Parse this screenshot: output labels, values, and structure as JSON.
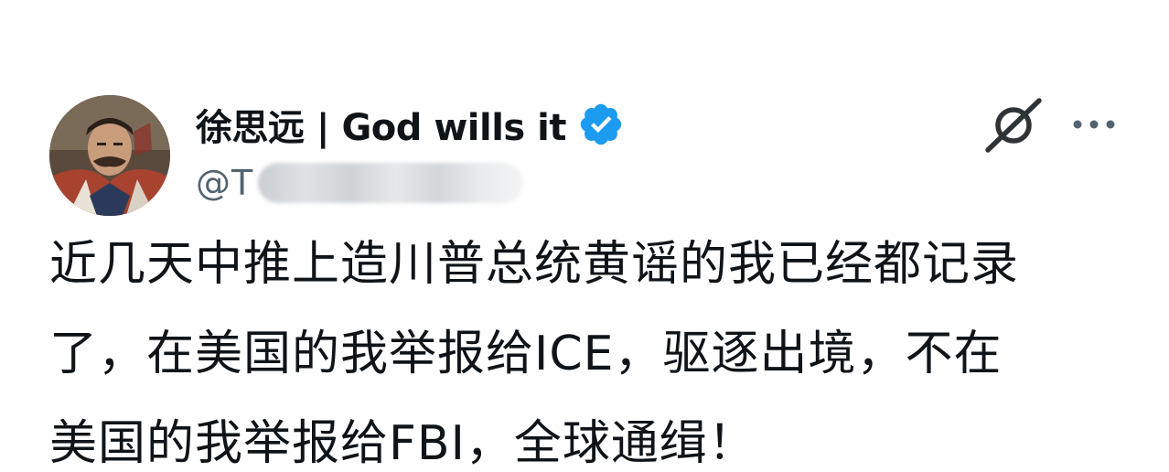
{
  "author": {
    "display_name": "徐思远 | God wills it",
    "handle_prefix": "@",
    "handle_visible": "T",
    "avatar_icon": "avatar-portrait",
    "verified_icon": "verified-badge-icon",
    "verified_color": "#1d9bf0"
  },
  "actions": {
    "grok_icon": "grok-icon",
    "more_icon": "more-icon"
  },
  "tweet": {
    "text": "近几天中推上造川普总统黄谣的我已经都记录\n了，在美国的我举报给ICE，驱逐出境，不在\n美国的我举报给FBI，全球通缉！"
  }
}
